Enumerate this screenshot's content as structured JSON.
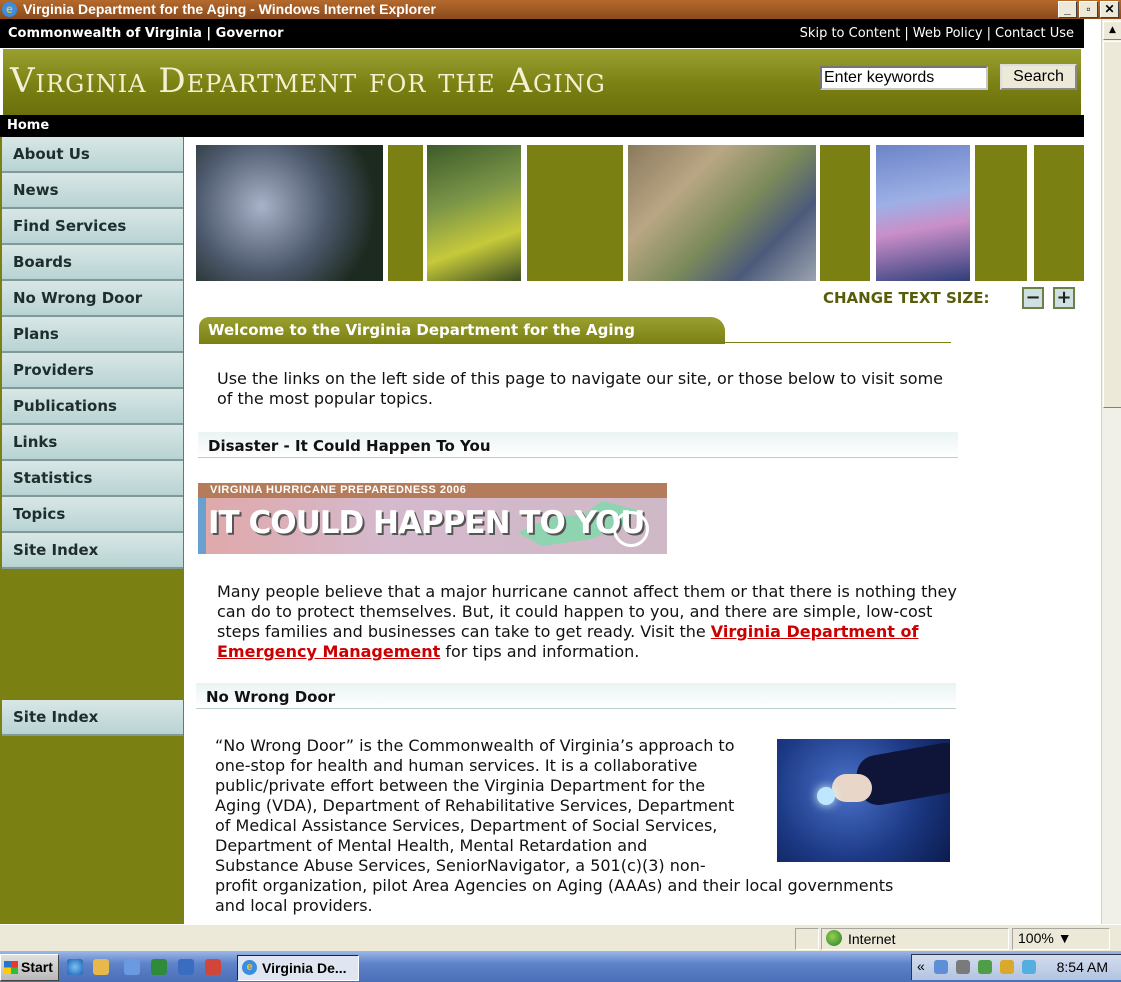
{
  "window": {
    "title": "Virginia Department for the Aging - Windows Internet Explorer",
    "ie_glyph": "e",
    "minimize": "_",
    "restore": "▫",
    "close": "✕"
  },
  "topbar": {
    "left": "Commonwealth of Virginia | Governor",
    "links": [
      "Skip to Content",
      "Web Policy",
      "Contact Use"
    ],
    "sep": "|"
  },
  "banner": {
    "logo": "Virginia Department for the Aging",
    "search_value": "Enter keywords",
    "search_button": "Search"
  },
  "homebar": {
    "label": "Home"
  },
  "nav": {
    "items": [
      "About Us",
      "News",
      "Find Services",
      "Boards",
      "No Wrong Door",
      "Plans",
      "Providers",
      "Publications",
      "Links",
      "Statistics",
      "Topics",
      "Site Index"
    ],
    "bottom_item": "Site Index"
  },
  "text_size": {
    "label": "CHANGE TEXT SIZE:",
    "decrease": "−",
    "increase": "+"
  },
  "welcome": {
    "heading": "Welcome to the Virginia Department for the Aging",
    "intro": "Use the links on the left side of this page to navigate our site, or those below to visit some of the most popular topics."
  },
  "disaster": {
    "heading": "Disaster - It Could Happen To You",
    "banner_strip": "VIRGINIA HURRICANE PREPAREDNESS 2006",
    "banner_big": "IT COULD HAPPEN TO YOU",
    "text_before": "Many people believe that a major hurricane cannot affect them or that there is nothing they can do to protect themselves. But, it could happen to you, and there are simple, low-cost steps families and businesses can take to get ready. Visit the ",
    "link": "Virginia Department of Emergency Management",
    "text_after": " for tips and information."
  },
  "nwd": {
    "heading": "No Wrong Door",
    "text": "“No Wrong Door” is the Commonwealth of Virginia’s approach to one-stop for health and human services.  It is a collaborative public/private effort between the Virginia Department for the Aging (VDA), Department of Rehabilitative Services, Department of Medical Assistance Services, Department of Social Services, Department of Mental Health, Mental Retardation and Substance Abuse Services, SeniorNavigator, a 501(c)(3) non-profit organization, pilot Area Agencies on Aging (AAAs) and their local governments and local providers."
  },
  "status": {
    "zone": "Internet",
    "zoom": "100%",
    "zoom_arrow": "▼"
  },
  "scroll": {
    "up": "▲",
    "down": "▼"
  },
  "taskbar": {
    "start": "Start",
    "task": "Virginia De...",
    "task_glyph": "e",
    "tray_chevron": "«",
    "clock": "8:54 AM"
  },
  "colors": {
    "olive": "#7a8012",
    "nav_bg": "#c8dede",
    "link_red": "#cc0000"
  }
}
